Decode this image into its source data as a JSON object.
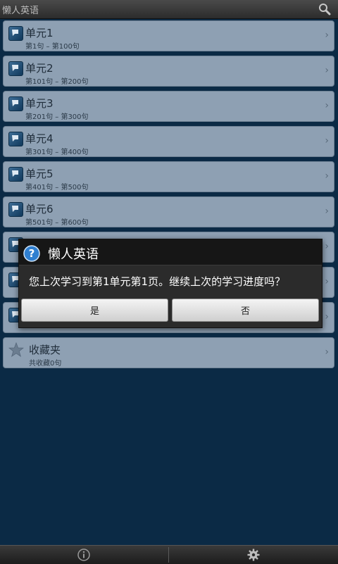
{
  "app": {
    "title": "懒人英语"
  },
  "list": {
    "items": [
      {
        "name": "单元1",
        "range": "第1句 – 第100句"
      },
      {
        "name": "单元2",
        "range": "第101句 – 第200句"
      },
      {
        "name": "单元3",
        "range": "第201句 – 第300句"
      },
      {
        "name": "单元4",
        "range": "第301句 – 第400句"
      },
      {
        "name": "单元5",
        "range": "第401句 – 第500句"
      },
      {
        "name": "单元6",
        "range": "第501句 – 第600句"
      },
      {
        "name": "",
        "range": ""
      },
      {
        "name": "",
        "range": ""
      },
      {
        "name": "",
        "range": ""
      }
    ],
    "favorites": {
      "name": "收藏夹",
      "subtitle": "共收藏0句",
      "icon": "star-icon"
    }
  },
  "dialog": {
    "title": "懒人英语",
    "message": "您上次学习到第1单元第1页。继续上次的学习进度吗？",
    "yes_label": "是",
    "no_label": "否",
    "icon": "question-icon"
  },
  "toolbar": {
    "info_icon": "info-icon",
    "settings_icon": "gear-icon"
  },
  "colors": {
    "background": "#0b2a45",
    "list_item": "#8ea0b3",
    "dialog": "#2b2b2b"
  }
}
